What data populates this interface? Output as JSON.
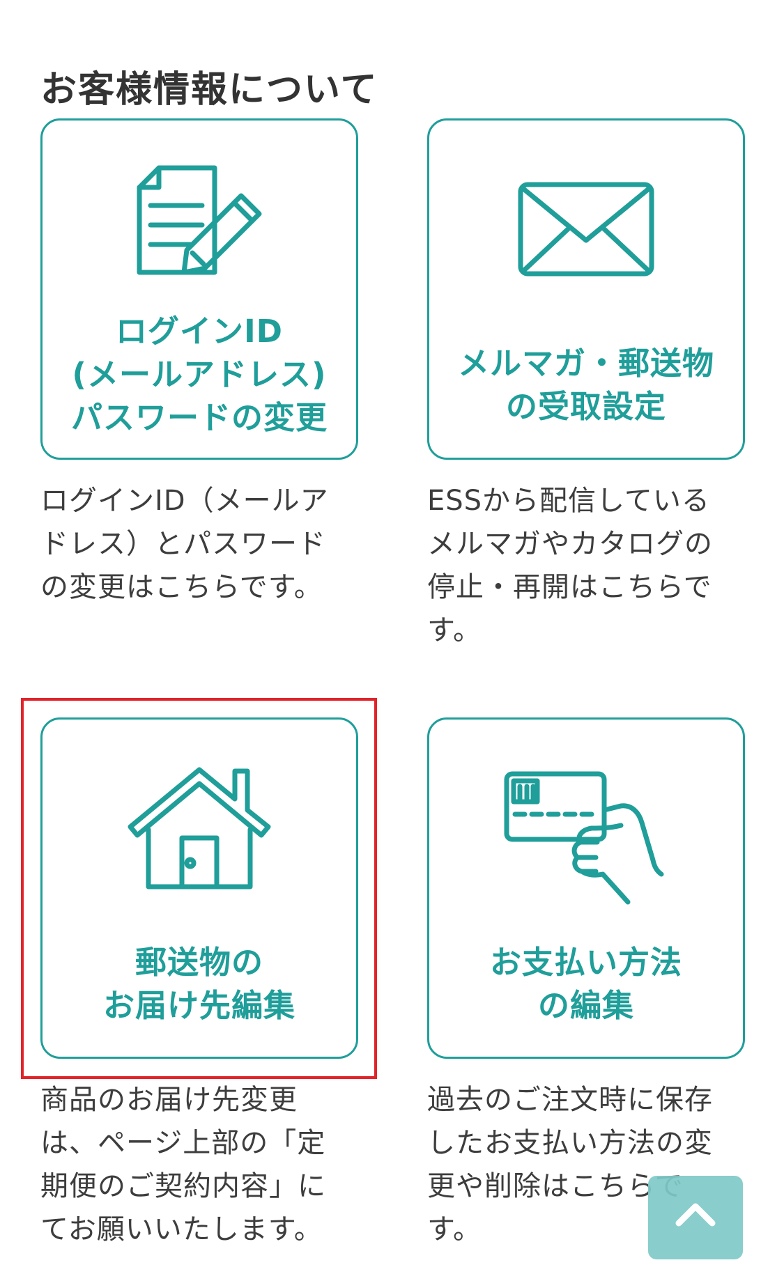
{
  "section": {
    "title": "お客様情報について"
  },
  "cards": [
    {
      "icon": "document-pencil-icon",
      "label": "ログインID\n(メールアドレス)\nパスワードの変更",
      "description": "ログインID（メールア\nドレス）とパスワード\nの変更はこちらです。"
    },
    {
      "icon": "envelope-icon",
      "label": "メルマガ・郵送物\nの受取設定",
      "description": "ESSから配信している\nメルマガやカタログの\n停止・再開はこちらで\nす。"
    },
    {
      "icon": "house-icon",
      "label": "郵送物の\nお届け先編集",
      "description": "商品のお届け先変更\nは、ページ上部の「定\n期便のご契約内容」に\nてお願いいたします。"
    },
    {
      "icon": "credit-card-hand-icon",
      "label": "お支払い方法\nの編集",
      "description": "過去のご注文時に保存\nしたお支払い方法の変\n更や削除はこちらで\nす。"
    }
  ],
  "scroll_top": {
    "icon": "chevron-up-icon"
  },
  "colors": {
    "accent": "#1f9e9a",
    "highlight": "#e1242b",
    "scroll_button": "#7fc9c8",
    "text": "#3d3d3d"
  }
}
